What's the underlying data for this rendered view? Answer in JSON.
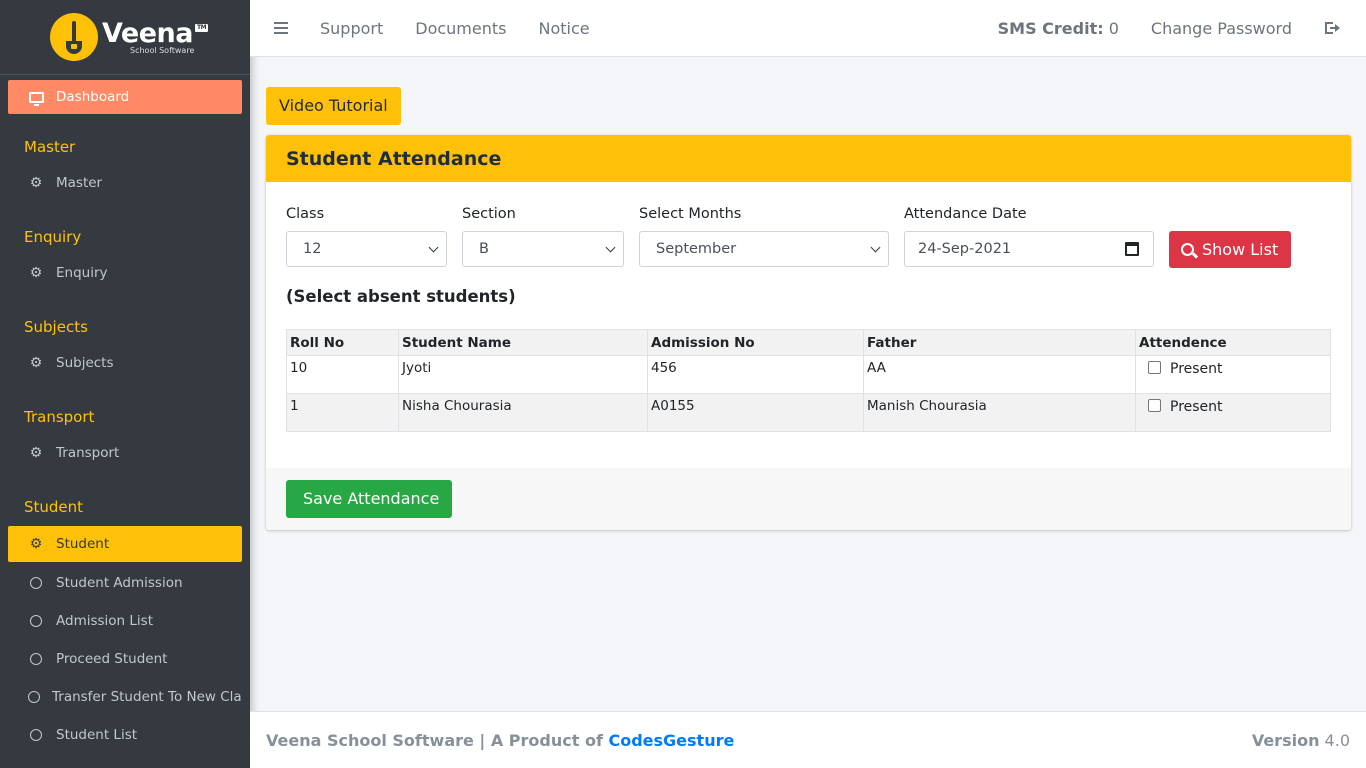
{
  "brand": {
    "name": "Veena",
    "badge": "TM",
    "subtitle": "School Software"
  },
  "sidebar": {
    "dashboard": "Dashboard",
    "sections": [
      {
        "header": "Master",
        "item": "Master"
      },
      {
        "header": "Enquiry",
        "item": "Enquiry"
      },
      {
        "header": "Subjects",
        "item": "Subjects"
      },
      {
        "header": "Transport",
        "item": "Transport"
      }
    ],
    "student_header": "Student",
    "student_item": "Student",
    "student_subitems": [
      "Student Admission",
      "Admission List",
      "Proceed Student",
      "Transfer Student To New Class",
      "Student List"
    ]
  },
  "topnav": {
    "links": [
      "Support",
      "Documents",
      "Notice"
    ],
    "sms_label": "SMS Credit:",
    "sms_value": "0",
    "change_password": "Change Password"
  },
  "page": {
    "video_tutorial": "Video Tutorial",
    "card_title": "Student Attendance",
    "form": {
      "class_label": "Class",
      "class_value": "12",
      "section_label": "Section",
      "section_value": "B",
      "months_label": "Select Months",
      "months_value": "September",
      "date_label": "Attendance Date",
      "date_value": "24-Sep-2021",
      "show_list": "Show List"
    },
    "absent_note": "(Select absent students)",
    "table": {
      "headers": [
        "Roll No",
        "Student Name",
        "Admission No",
        "Father",
        "Attendence"
      ],
      "rows": [
        {
          "roll": "10",
          "name": "Jyoti",
          "admission": "456",
          "father": "AA",
          "attendance": "Present"
        },
        {
          "roll": "1",
          "name": "Nisha Chourasia",
          "admission": "A0155",
          "father": "Manish Chourasia",
          "attendance": "Present"
        }
      ]
    },
    "save_button": "Save Attendance"
  },
  "footer": {
    "text": "Veena School Software | A Product of",
    "link": "CodesGesture",
    "version_label": "Version",
    "version_value": "4.0"
  },
  "colors": {
    "sidebar": "#343a40",
    "accent_yellow": "#ffc107",
    "dashboard_orange": "#ff8a65",
    "danger": "#dc3545",
    "success": "#28a745",
    "link_blue": "#007bff"
  }
}
